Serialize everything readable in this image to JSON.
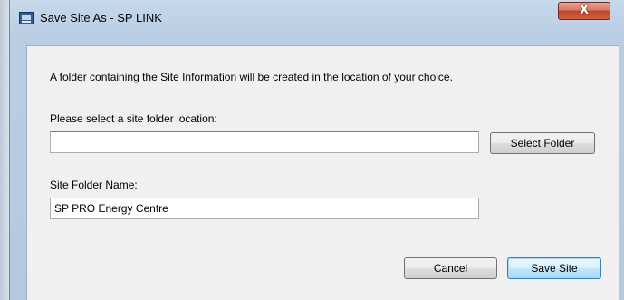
{
  "window": {
    "title": "Save Site As - SP LINK",
    "close_glyph": "X"
  },
  "dialog": {
    "info_text": "A folder containing the Site Information will be created in the location of your choice.",
    "location_label": "Please select a site folder location:",
    "location_value": "",
    "select_folder_label": "Select Folder",
    "folder_name_label": "Site Folder Name:",
    "folder_name_value": "SP PRO Energy Centre",
    "cancel_label": "Cancel",
    "save_label": "Save Site"
  },
  "icons": {
    "app": "app-window-icon",
    "close": "close-icon"
  },
  "colors": {
    "close_button": "#c7462a",
    "default_button_border": "#3c7fb1",
    "window_frame": "#b9cde3",
    "client_background": "#f0f0f0"
  }
}
